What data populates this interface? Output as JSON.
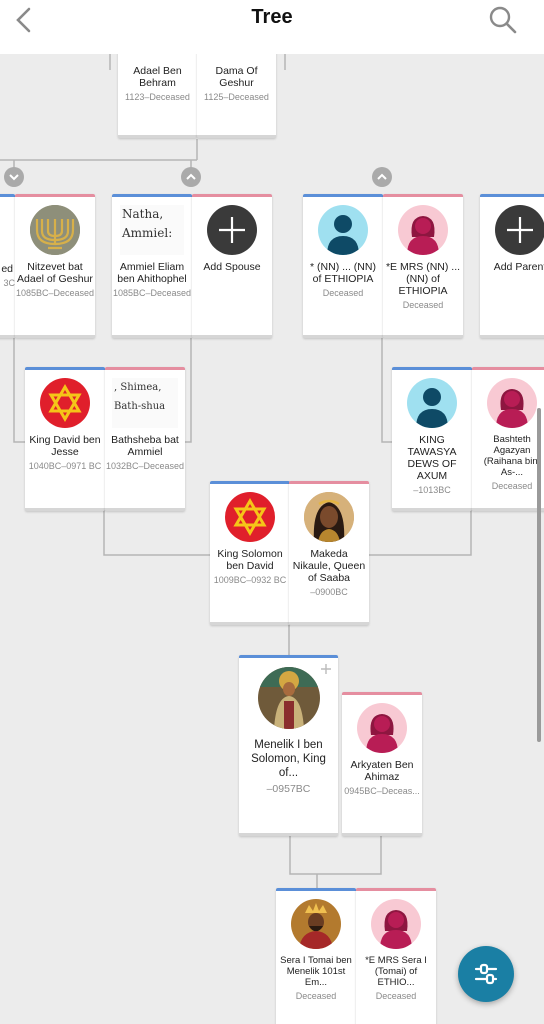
{
  "header": {
    "title": "Tree",
    "back_icon": "chevron-left-icon",
    "search_icon": "search-icon"
  },
  "colors": {
    "male": "#5b8fd8",
    "female": "#e58ea0",
    "fab": "#1a7fa4"
  },
  "people": {
    "adael": {
      "name": "Adael Ben Behram",
      "dates": "1123–Deceased"
    },
    "dama": {
      "name": "Dama Of Geshur",
      "dates": "1125–Deceased"
    },
    "partial": {
      "name": "ed",
      "dates": "3C"
    },
    "nitzevet": {
      "name": "Nitzevet bat Adael of Geshur",
      "dates": "1085BC–Deceased"
    },
    "ammiel": {
      "name": "Ammiel Eliam ben Ahithophel",
      "dates": "1085BC–Deceased",
      "doc_text": "Natha,\nAmmiel:"
    },
    "add_spouse": {
      "name": "Add Spouse"
    },
    "nn_male": {
      "name": "* (NN) ... (NN) of ETHIOPIA",
      "dates": "Deceased"
    },
    "nn_female": {
      "name": "*E MRS (NN) ... (NN) of ETHIOPIA",
      "dates": "Deceased"
    },
    "add_parent": {
      "name": "Add Parent"
    },
    "david": {
      "name": "King David ben Jesse",
      "dates": "1040BC–0971 BC"
    },
    "bathsheba": {
      "name": "Bathsheba bat Ammiel",
      "dates": "1032BC–Deceased",
      "doc_text": ", Shimea,\nBath-shua"
    },
    "tawasya": {
      "name": "KING TAWASYA DEWS OF AXUM",
      "dates": "–1013BC"
    },
    "bashteth": {
      "name": "Bashteth Agazyan (Raihana bint As-...",
      "dates": "Deceased"
    },
    "solomon": {
      "name": "King Solomon ben David",
      "dates": "1009BC–0932 BC"
    },
    "makeda": {
      "name": "Makeda Nikaule, Queen of Saaba",
      "dates": "–0900BC"
    },
    "menelik": {
      "name": "Menelik I ben Solomon, King of...",
      "dates": "–0957BC"
    },
    "arkyaten": {
      "name": "Arkyaten Ben Ahimaz",
      "dates": "0945BC–Deceas..."
    },
    "sera": {
      "name": "Sera I Tomai ben Menelik 101st Em...",
      "dates": "Deceased"
    },
    "mrs_sera": {
      "name": "*E MRS Sera I (Tomai) of ETHIO...",
      "dates": "Deceased"
    }
  },
  "fab": {
    "icon": "filter-sliders-icon"
  }
}
